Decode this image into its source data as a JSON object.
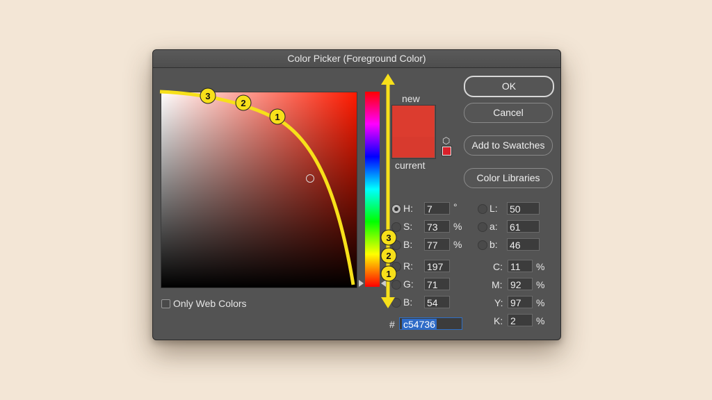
{
  "dialog": {
    "title": "Color Picker (Foreground Color)"
  },
  "swatch": {
    "new_label": "new",
    "current_label": "current",
    "new_color": "#dc3c2f",
    "current_color": "#d83a2e",
    "gamut_warning_icon": "3d-cube-icon"
  },
  "buttons": {
    "ok": "OK",
    "cancel": "Cancel",
    "add_to_swatches": "Add to Swatches",
    "color_libraries": "Color Libraries"
  },
  "hsb": {
    "h": {
      "label": "H:",
      "value": "7",
      "unit": "°",
      "selected": true
    },
    "s": {
      "label": "S:",
      "value": "73",
      "unit": "%"
    },
    "b": {
      "label": "B:",
      "value": "77",
      "unit": "%"
    }
  },
  "rgb": {
    "r": {
      "label": "R:",
      "value": "197"
    },
    "g": {
      "label": "G:",
      "value": "71"
    },
    "b": {
      "label": "B:",
      "value": "54"
    }
  },
  "lab": {
    "l": {
      "label": "L:",
      "value": "50"
    },
    "a": {
      "label": "a:",
      "value": "61"
    },
    "b": {
      "label": "b:",
      "value": "46"
    }
  },
  "cmyk": {
    "c": {
      "label": "C:",
      "value": "11",
      "unit": "%"
    },
    "m": {
      "label": "M:",
      "value": "92",
      "unit": "%"
    },
    "y": {
      "label": "Y:",
      "value": "97",
      "unit": "%"
    },
    "k": {
      "label": "K:",
      "value": "2",
      "unit": "%"
    }
  },
  "hex": {
    "prefix": "#",
    "value": "c54736"
  },
  "only_web_colors": {
    "label": "Only Web Colors",
    "checked": false
  },
  "annotations": {
    "accent_color": "#f7e01a",
    "badges": [
      "1",
      "2",
      "3"
    ]
  }
}
